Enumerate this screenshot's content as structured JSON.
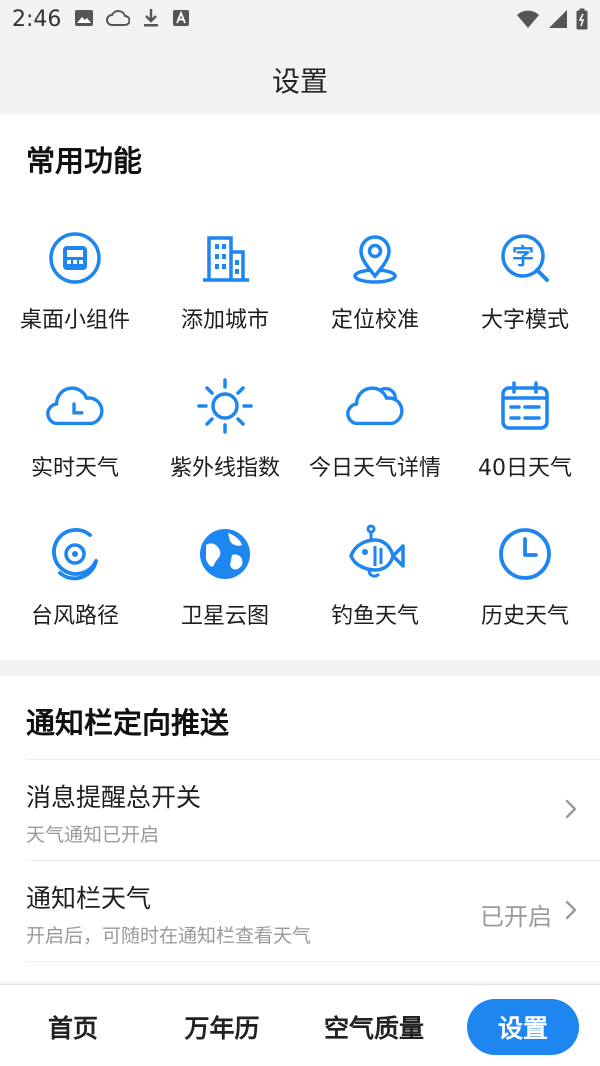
{
  "status_bar": {
    "time": "2:46"
  },
  "header": {
    "title": "设置"
  },
  "functions": {
    "title": "常用功能",
    "accent_color": "#1d86f0",
    "items": [
      {
        "label": "桌面小组件",
        "icon": "widget-icon"
      },
      {
        "label": "添加城市",
        "icon": "building-icon"
      },
      {
        "label": "定位校准",
        "icon": "location-pin-icon"
      },
      {
        "label": "大字模式",
        "icon": "large-text-icon"
      },
      {
        "label": "实时天气",
        "icon": "cloud-clock-icon"
      },
      {
        "label": "紫外线指数",
        "icon": "sun-icon"
      },
      {
        "label": "今日天气详情",
        "icon": "cloud-icon"
      },
      {
        "label": "40日天气",
        "icon": "calendar-icon"
      },
      {
        "label": "台风路径",
        "icon": "typhoon-icon"
      },
      {
        "label": "卫星云图",
        "icon": "globe-icon"
      },
      {
        "label": "钓鱼天气",
        "icon": "fish-icon"
      },
      {
        "label": "历史天气",
        "icon": "history-clock-icon"
      }
    ]
  },
  "notify": {
    "title": "通知栏定向推送",
    "rows": [
      {
        "title": "消息提醒总开关",
        "subtitle": "天气通知已开启",
        "value": ""
      },
      {
        "title": "通知栏天气",
        "subtitle": "开启后，可随时在通知栏查看天气",
        "value": "已开启"
      }
    ]
  },
  "tabbar": {
    "tabs": [
      {
        "label": "首页",
        "active": false
      },
      {
        "label": "万年历",
        "active": false
      },
      {
        "label": "空气质量",
        "active": false
      },
      {
        "label": "设置",
        "active": true
      }
    ]
  }
}
